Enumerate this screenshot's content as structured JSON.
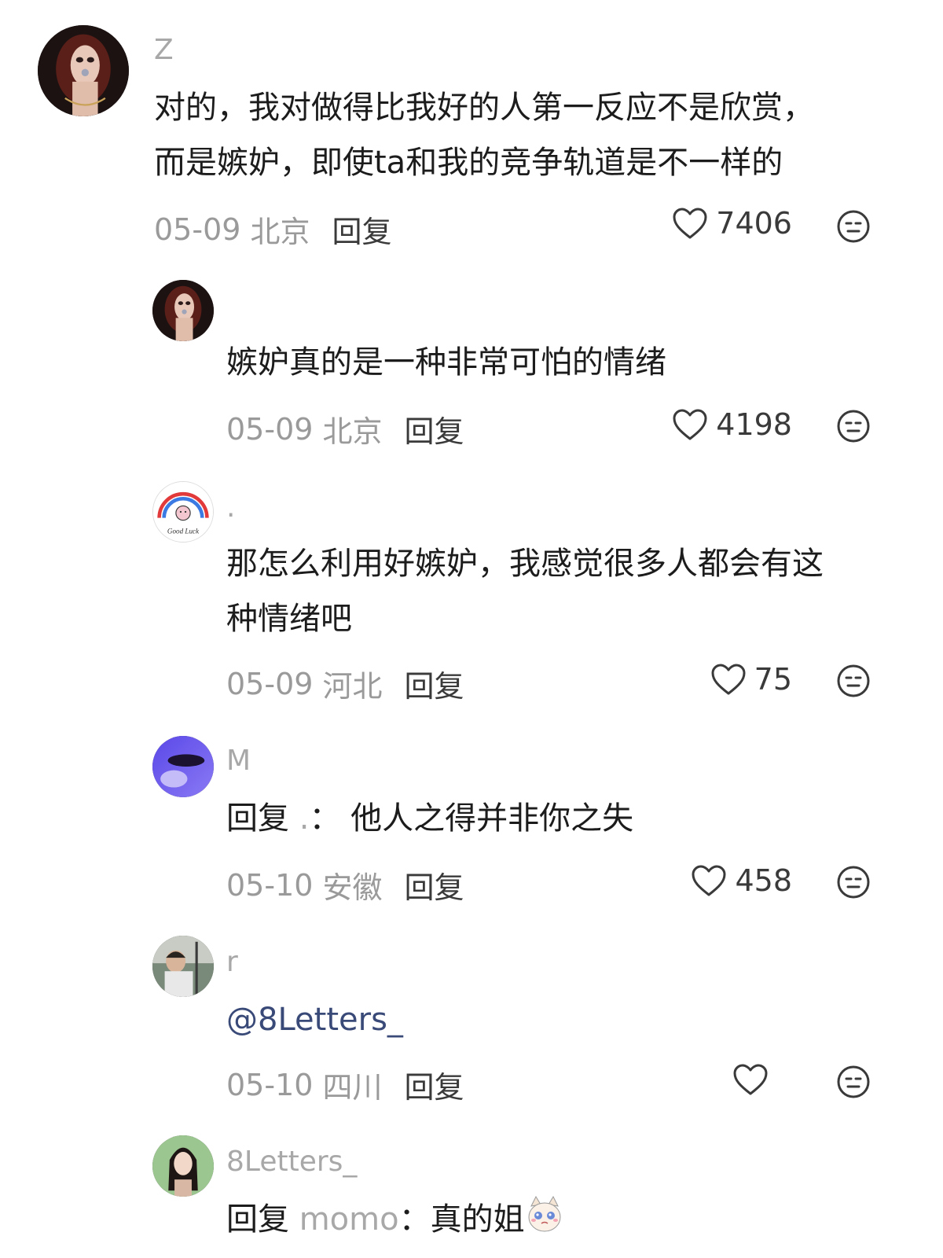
{
  "comments": [
    {
      "username": "Z",
      "text_line1": "对的，我对做得比我好的人第一反应不是欣赏，",
      "text_line2": "而是嫉妒，即使ta和我的竞争轨道是不一样的",
      "date": "05-09",
      "location": "北京",
      "reply_label": "回复",
      "likes": "7406"
    },
    {
      "username": "",
      "text": "嫉妒真的是一种非常可怕的情绪",
      "date": "05-09",
      "location": "北京",
      "reply_label": "回复",
      "likes": "4198"
    },
    {
      "username": ".",
      "avatar_caption": "Good Luck",
      "text_line1": "那怎么利用好嫉妒，我感觉很多人都会有这",
      "text_line2": "种情绪吧",
      "date": "05-09",
      "location": "河北",
      "reply_label": "回复",
      "likes": "75"
    },
    {
      "username": "M",
      "reply_prefix": "回复",
      "reply_to": ".",
      "reply_sep": "：",
      "text": "他人之得并非你之失",
      "date": "05-10",
      "location": "安徽",
      "reply_label": "回复",
      "likes": "458"
    },
    {
      "username": "r",
      "mention": "@8Letters_",
      "date": "05-10",
      "location": "四川",
      "reply_label": "回复",
      "likes": ""
    },
    {
      "username": "8Letters_",
      "reply_prefix": "回复",
      "reply_to": "momo",
      "reply_sep": "：",
      "text": "真的姐"
    }
  ],
  "colors": {
    "text": "#1c1c1c",
    "muted": "#9a9a9a",
    "mention": "#3a4a78"
  },
  "icons": [
    "heart-icon",
    "emoji-face-icon",
    "crying-cat-emoji"
  ]
}
